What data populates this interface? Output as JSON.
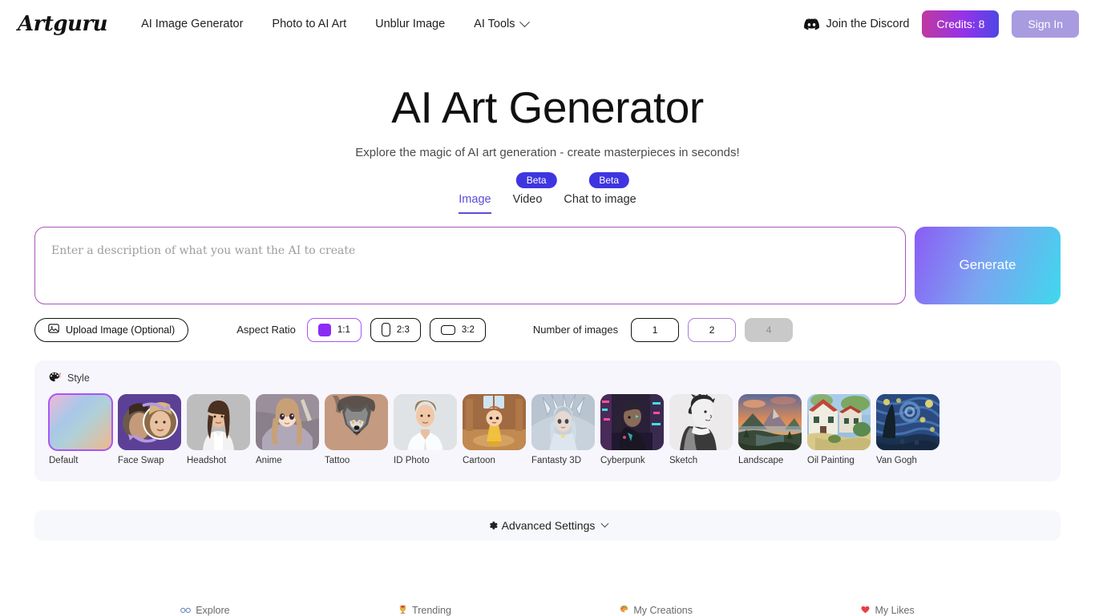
{
  "header": {
    "logo": "Artguru",
    "nav": [
      {
        "label": "AI Image Generator",
        "caret": false
      },
      {
        "label": "Photo to AI Art",
        "caret": false
      },
      {
        "label": "Unblur Image",
        "caret": false
      },
      {
        "label": "AI Tools",
        "caret": true
      }
    ],
    "discord_label": "Join the Discord",
    "credits_label": "Credits: 8",
    "signin_label": "Sign In"
  },
  "hero": {
    "title": "AI Art Generator",
    "subtitle": "Explore the magic of AI art generation - create masterpieces in seconds!"
  },
  "tabs": [
    {
      "label": "Image",
      "active": true,
      "beta": null
    },
    {
      "label": "Video",
      "active": false,
      "beta": "Beta"
    },
    {
      "label": "Chat to image",
      "active": false,
      "beta": "Beta"
    }
  ],
  "prompt": {
    "value": "",
    "placeholder": "Enter a description of what you want the AI to create",
    "generate_label": "Generate"
  },
  "controls": {
    "upload_label": "Upload Image (Optional)",
    "aspect_ratio_label": "Aspect Ratio",
    "aspect_ratios": [
      {
        "label": "1:1",
        "selected": true
      },
      {
        "label": "2:3",
        "selected": false
      },
      {
        "label": "3:2",
        "selected": false
      }
    ],
    "number_label": "Number of images",
    "numbers": [
      {
        "label": "1",
        "selected": false,
        "disabled": false
      },
      {
        "label": "2",
        "selected": true,
        "disabled": false
      },
      {
        "label": "4",
        "selected": false,
        "disabled": true
      }
    ]
  },
  "style": {
    "header_label": "Style",
    "items": [
      {
        "label": "Default",
        "selected": true
      },
      {
        "label": "Face Swap",
        "selected": false
      },
      {
        "label": "Headshot",
        "selected": false
      },
      {
        "label": "Anime",
        "selected": false
      },
      {
        "label": "Tattoo",
        "selected": false
      },
      {
        "label": "ID Photo",
        "selected": false
      },
      {
        "label": "Cartoon",
        "selected": false
      },
      {
        "label": "Fantasty 3D",
        "selected": false
      },
      {
        "label": "Cyberpunk",
        "selected": false
      },
      {
        "label": "Sketch",
        "selected": false
      },
      {
        "label": "Landscape",
        "selected": false
      },
      {
        "label": "Oil Painting",
        "selected": false
      },
      {
        "label": "Van Gogh",
        "selected": false
      }
    ]
  },
  "advanced": {
    "label": "Advanced Settings"
  },
  "bottom_nav": [
    {
      "label": "Explore",
      "icon": "glasses-icon"
    },
    {
      "label": "Trending",
      "icon": "trophy-icon"
    },
    {
      "label": "My Creations",
      "icon": "palette-icon"
    },
    {
      "label": "My Likes",
      "icon": "heart-icon"
    }
  ],
  "colors": {
    "accent_purple": "#8b2cf5",
    "tab_active": "#5b4ddb",
    "beta_badge": "#3f35e0",
    "prompt_border": "#a855bb"
  }
}
